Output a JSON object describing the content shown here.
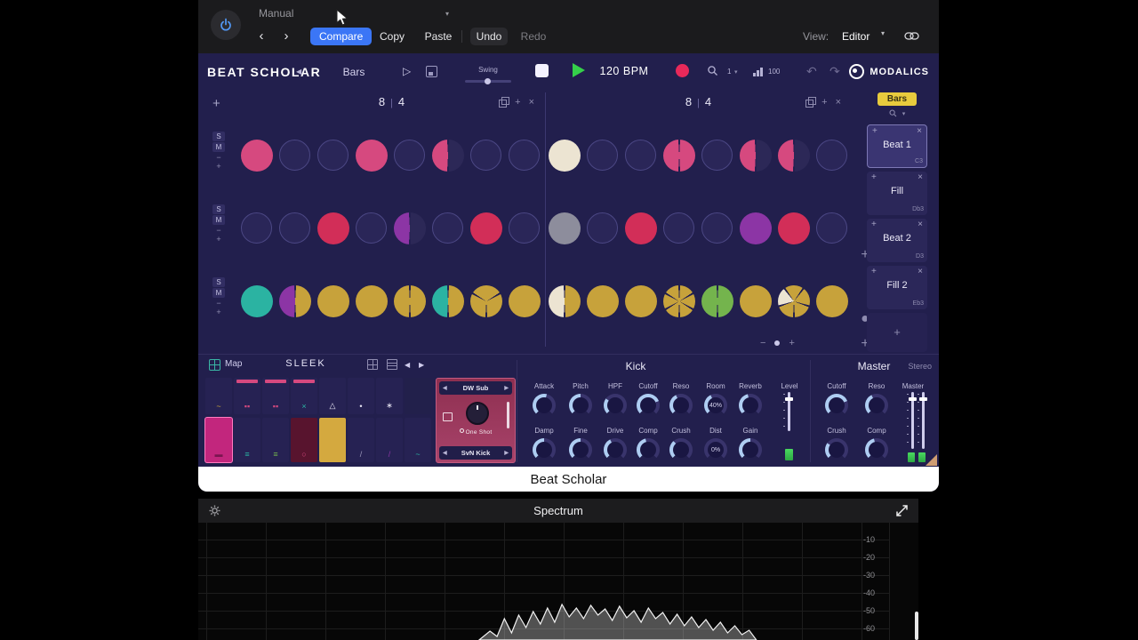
{
  "glyphs": {
    "plus": "+",
    "minus": "−",
    "close": "×",
    "pipe": "|",
    "back": "‹",
    "forward": "›",
    "collapse": "◀",
    "next": "▶",
    "caret": "▾",
    "play_outline": "▷",
    "undo_arrow": "↶",
    "redo_arrow": "↷"
  },
  "colors": {
    "pink": "#d6497f",
    "red": "#d22e58",
    "white": "#ece4d2",
    "gray": "#8d8d9c",
    "purple": "#8c35a5",
    "gold": "#c7a23b",
    "teal": "#2bb3a2",
    "green": "#74b44d",
    "dark": "#2c2857",
    "divider": "#232050"
  },
  "host": {
    "preset": "Manual",
    "compare": "Compare",
    "copy": "Copy",
    "paste": "Paste",
    "undo": "Undo",
    "redo": "Redo",
    "view_label": "View:",
    "view_value": "Editor"
  },
  "transport": {
    "logo": "BEAT SCHOLAR",
    "bars": "Bars",
    "swing": "Swing",
    "bpm": "120 BPM",
    "zoom": "1",
    "velocity": "100",
    "brand": "MODALICS"
  },
  "grid": {
    "sections": [
      {
        "num": "8",
        "den": "4"
      },
      {
        "num": "8",
        "den": "4"
      }
    ],
    "row_buttons": {
      "solo": "S",
      "mute": "M",
      "minus": "−",
      "plus": "+"
    },
    "rows": [
      {
        "steps": [
          [
            "pink"
          ],
          [],
          [],
          [
            "pink"
          ],
          [],
          [
            "pink",
            "dark"
          ],
          [],
          [],
          [
            "white"
          ],
          [],
          [],
          [
            "pink",
            "pink"
          ],
          [],
          [
            "pink",
            "dark"
          ],
          [
            "pink",
            "dark"
          ],
          []
        ]
      },
      {
        "steps": [
          [],
          [],
          [
            "red"
          ],
          [],
          [
            "purple",
            "dark"
          ],
          [],
          [
            "red"
          ],
          [],
          [
            "gray"
          ],
          [],
          [
            "red"
          ],
          [],
          [],
          [
            "purple"
          ],
          [
            "red"
          ],
          []
        ]
      },
      {
        "steps": [
          [
            "teal"
          ],
          [
            "purple",
            "gold"
          ],
          [
            "gold"
          ],
          [
            "gold"
          ],
          [
            "gold",
            "gold"
          ],
          [
            "teal",
            "gold"
          ],
          [
            "gold",
            "gold",
            "gold"
          ],
          [
            "gold"
          ],
          [
            "white",
            "gold"
          ],
          [
            "gold"
          ],
          [
            "gold"
          ],
          [
            "gold",
            "gold",
            "gold",
            "gold",
            "gold",
            "gold"
          ],
          [
            "green",
            "green"
          ],
          [
            "gold"
          ],
          [
            "gold",
            "white",
            "gold",
            "gold",
            "gold"
          ],
          [
            "gold"
          ]
        ]
      }
    ]
  },
  "sidebar": {
    "bars_button": "Bars",
    "patterns": [
      {
        "name": "Beat 1",
        "note": "C3",
        "selected": true
      },
      {
        "name": "Fill",
        "note": "Db3",
        "selected": false
      },
      {
        "name": "Beat 2",
        "note": "D3",
        "selected": false
      },
      {
        "name": "Fill 2",
        "note": "Eb3",
        "selected": false
      }
    ]
  },
  "sampler": {
    "map": "Map",
    "kit": "SLEEK",
    "engine": "DW Sub",
    "mode": "One Shot",
    "sample": "SvN Kick",
    "pads": [
      [
        {
          "bg": "#262253",
          "icon": "~",
          "ic": "#c7a23b"
        },
        {
          "bg": "#262253",
          "strip": "#d6497f",
          "icon": "▪▪",
          "ic": "#d6497f"
        },
        {
          "bg": "#262253",
          "strip": "#d6497f",
          "icon": "▪▪",
          "ic": "#d6497f"
        },
        {
          "bg": "#262253",
          "strip": "#d6497f",
          "icon": "×",
          "ic": "#2bb3a2"
        },
        {
          "bg": "#262253",
          "icon": "△",
          "ic": "#e8e6f4"
        },
        {
          "bg": "#262253",
          "icon": "•",
          "ic": "#e8e6f4"
        },
        {
          "bg": "#262253",
          "icon": "∗",
          "ic": "#e8e6f4"
        },
        {
          "bg": "#22204b",
          "icon": "",
          "ic": ""
        }
      ],
      [
        {
          "bg": "#c2267d",
          "sel": true,
          "icon": "▬",
          "ic": "#7a1550"
        },
        {
          "bg": "#262253",
          "icon": "≡",
          "ic": "#2bb3a2"
        },
        {
          "bg": "#262253",
          "icon": "≡",
          "ic": "#74b44d"
        },
        {
          "bg": "#58142e",
          "icon": "○",
          "ic": "#d6497f"
        },
        {
          "bg": "#d4a93f",
          "icon": "",
          "ic": ""
        },
        {
          "bg": "#262253",
          "icon": "/",
          "ic": "#9a97b8"
        },
        {
          "bg": "#262253",
          "icon": "/",
          "ic": "#8c35a5"
        },
        {
          "bg": "#262253",
          "icon": "~",
          "ic": "#2bb3a2"
        }
      ]
    ]
  },
  "kick": {
    "title": "Kick",
    "level_label": "Level",
    "rows": [
      [
        {
          "label": "Attack",
          "pct": 55
        },
        {
          "label": "Pitch",
          "pct": 50
        },
        {
          "label": "HPF",
          "pct": 30
        },
        {
          "label": "Cutoff",
          "pct": 75
        },
        {
          "label": "Reso",
          "pct": 40
        },
        {
          "label": "Room",
          "pct": 40,
          "display": "40%"
        },
        {
          "label": "Reverb",
          "pct": 45
        }
      ],
      [
        {
          "label": "Damp",
          "pct": 50
        },
        {
          "label": "Fine",
          "pct": 50
        },
        {
          "label": "Drive",
          "pct": 40
        },
        {
          "label": "Comp",
          "pct": 45
        },
        {
          "label": "Crush",
          "pct": 35
        },
        {
          "label": "Dist",
          "pct": 0,
          "display": "0%"
        },
        {
          "label": "Gain",
          "pct": 50
        }
      ]
    ]
  },
  "master": {
    "title": "Master",
    "mode": "Stereo",
    "fader_label": "Master",
    "rows": [
      [
        {
          "label": "Cutoff",
          "pct": 75
        },
        {
          "label": "Reso",
          "pct": 40
        }
      ],
      [
        {
          "label": "Crush",
          "pct": 30
        },
        {
          "label": "Comp",
          "pct": 45
        }
      ]
    ]
  },
  "footer": {
    "title": "Beat Scholar"
  },
  "spectrum": {
    "title": "Spectrum",
    "db_labels": [
      "-10",
      "-20",
      "-30",
      "-40",
      "-50",
      "-60"
    ],
    "curve": [
      [
        0.39,
        132
      ],
      [
        0.405,
        122
      ],
      [
        0.415,
        128
      ],
      [
        0.425,
        108
      ],
      [
        0.435,
        124
      ],
      [
        0.445,
        104
      ],
      [
        0.455,
        118
      ],
      [
        0.465,
        100
      ],
      [
        0.475,
        114
      ],
      [
        0.485,
        96
      ],
      [
        0.495,
        112
      ],
      [
        0.505,
        92
      ],
      [
        0.515,
        106
      ],
      [
        0.525,
        96
      ],
      [
        0.535,
        108
      ],
      [
        0.545,
        93
      ],
      [
        0.555,
        104
      ],
      [
        0.565,
        97
      ],
      [
        0.575,
        110
      ],
      [
        0.585,
        94
      ],
      [
        0.595,
        107
      ],
      [
        0.605,
        99
      ],
      [
        0.615,
        112
      ],
      [
        0.625,
        96
      ],
      [
        0.635,
        108
      ],
      [
        0.645,
        101
      ],
      [
        0.655,
        114
      ],
      [
        0.665,
        103
      ],
      [
        0.675,
        116
      ],
      [
        0.685,
        106
      ],
      [
        0.695,
        118
      ],
      [
        0.705,
        109
      ],
      [
        0.715,
        121
      ],
      [
        0.725,
        112
      ],
      [
        0.735,
        124
      ],
      [
        0.745,
        116
      ],
      [
        0.755,
        126
      ],
      [
        0.765,
        121
      ],
      [
        0.775,
        132
      ]
    ]
  }
}
